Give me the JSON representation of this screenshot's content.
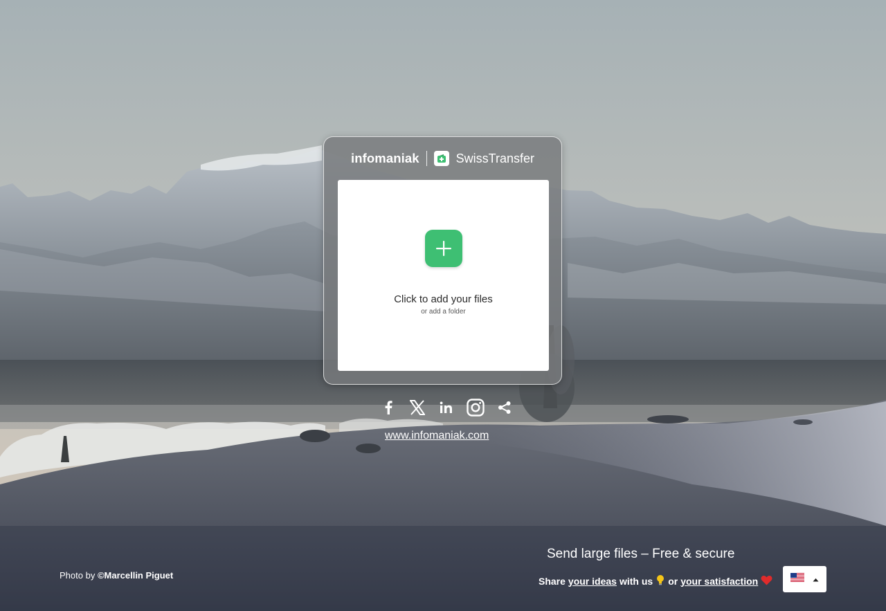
{
  "brand": {
    "company": "infomaniak",
    "product": "SwissTransfer",
    "icons": {
      "product_logo": "swisstransfer-logo-icon"
    }
  },
  "dropzone": {
    "title": "Click to add your files",
    "subtitle_prefix": "or ",
    "subtitle_link": "add a folder",
    "icons": {
      "add": "plus-icon"
    }
  },
  "socials": {
    "items": [
      "facebook-icon",
      "x-icon",
      "linkedin-icon",
      "instagram-icon",
      "share-icon"
    ]
  },
  "footer": {
    "website": "www.infomaniak.com",
    "photo_prefix": "Photo by ",
    "photo_author": "©Marcellin Piguet",
    "tagline": "Send large files – Free & secure",
    "feedback_share": "Share",
    "feedback_ideas": "your ideas",
    "feedback_with_us": "with us",
    "feedback_or": "or",
    "feedback_satisfaction": "your satisfaction",
    "language_icon": "us-flag-icon"
  },
  "colors": {
    "accent": "#3ebf73",
    "card": "#787a7c",
    "text_on_dark": "#ffffff"
  }
}
